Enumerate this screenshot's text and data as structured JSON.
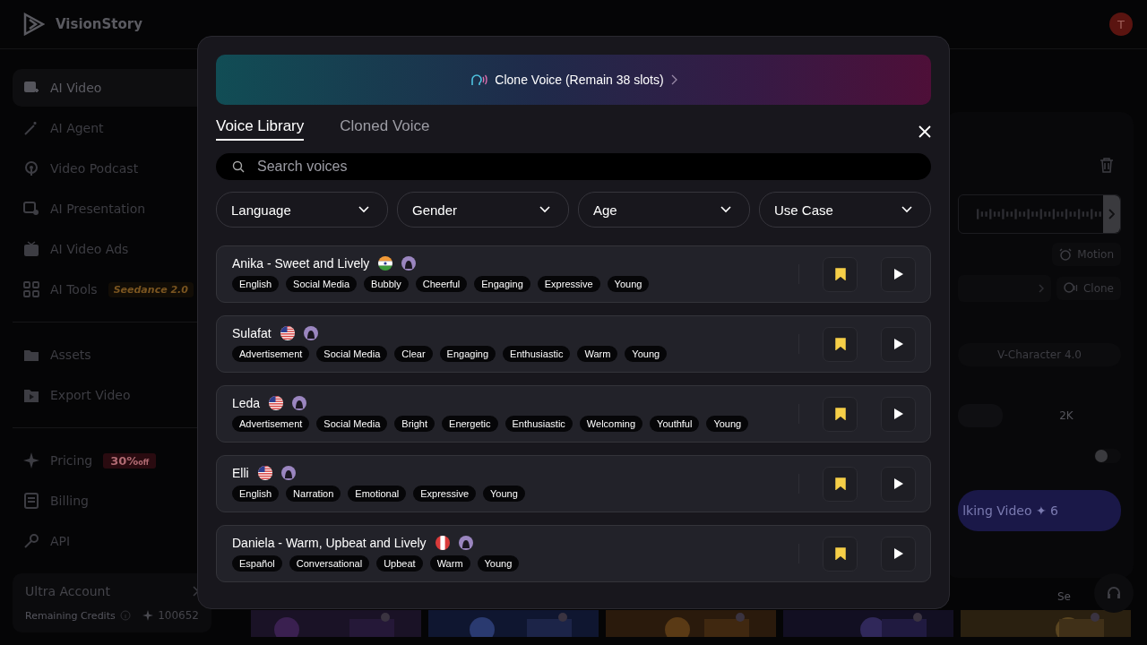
{
  "header": {
    "logo": "VisionStory",
    "avatar": "T"
  },
  "sidebar": {
    "items": [
      {
        "label": "AI Video",
        "selected": true
      },
      {
        "label": "AI Agent",
        "selected": false
      },
      {
        "label": "Video Podcast",
        "selected": false
      },
      {
        "label": "AI Presentation",
        "selected": false
      },
      {
        "label": "AI Video Ads",
        "selected": false
      },
      {
        "label": "AI Tools",
        "selected": false,
        "badge": "Seedance 2.0"
      },
      {
        "kind": "divider"
      },
      {
        "label": "Assets",
        "selected": false
      },
      {
        "label": "Export Video",
        "selected": false
      },
      {
        "kind": "divider"
      },
      {
        "label": "Pricing",
        "selected": false,
        "badge": "30%",
        "badge_sub": "off"
      },
      {
        "label": "Billing",
        "selected": false
      },
      {
        "label": "API",
        "selected": false
      }
    ],
    "account": {
      "title": "Ultra Account",
      "credits_label": "Remaining Credits",
      "credits": "100652"
    }
  },
  "background_panel": {
    "motion": "Motion",
    "clone": "Clone",
    "model": "V-Character 4.0",
    "resolution": "2K",
    "toggle_on": false,
    "generate": "lking Video ✦ 6",
    "see": "Se"
  },
  "modal": {
    "banner": "Clone Voice (Remain 38 slots)",
    "tabs": [
      {
        "label": "Voice Library",
        "selected": true
      },
      {
        "label": "Cloned Voice",
        "selected": false
      }
    ],
    "search": {
      "placeholder": "Search voices"
    },
    "filters": [
      "Language",
      "Gender",
      "Age",
      "Use Case"
    ],
    "voices": [
      {
        "name": "Anika - Sweet and Lively",
        "saved": true,
        "tags": [
          "English",
          "Social Media",
          "Bubbly",
          "Cheerful",
          "Engaging",
          "Expressive",
          "Young"
        ]
      },
      {
        "name": "Sulafat",
        "saved": true,
        "tags": [
          "Advertisement",
          "Social Media",
          "Clear",
          "Engaging",
          "Enthusiastic",
          "Warm",
          "Young"
        ]
      },
      {
        "name": "Leda",
        "saved": true,
        "tags": [
          "Advertisement",
          "Social Media",
          "Bright",
          "Energetic",
          "Enthusiastic",
          "Welcoming",
          "Youthful",
          "Young"
        ]
      },
      {
        "name": "Elli",
        "saved": true,
        "tags": [
          "English",
          "Narration",
          "Emotional",
          "Expressive",
          "Young"
        ]
      },
      {
        "name": "Daniela - Warm, Upbeat and Lively",
        "saved": true,
        "tags": [
          "Español",
          "Conversational",
          "Upbeat",
          "Warm",
          "Young"
        ]
      }
    ]
  }
}
